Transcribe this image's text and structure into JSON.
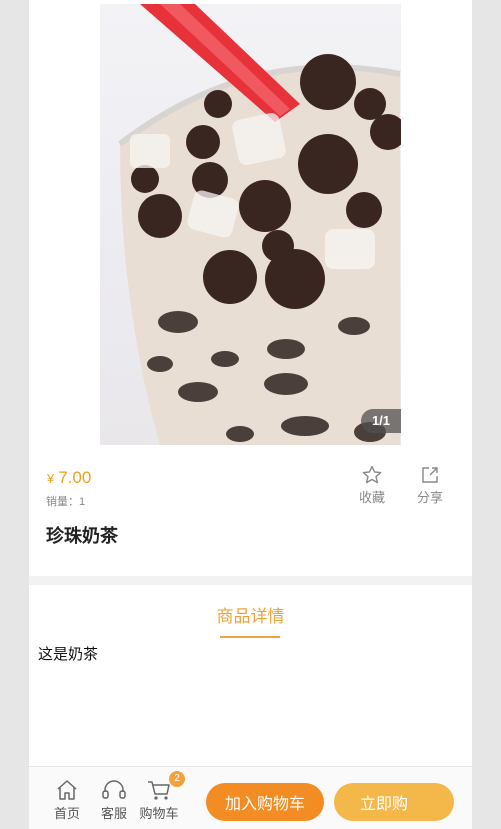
{
  "product": {
    "image_pager": "1/1",
    "currency": "¥",
    "price": "7.00",
    "sales": "销量：1",
    "name": "珍珠奶茶"
  },
  "actions": {
    "favorite_label": "收藏",
    "share_label": "分享"
  },
  "detail": {
    "tab_label": "商品详情",
    "description": "这是奶茶"
  },
  "bottom_nav": {
    "home_label": "首页",
    "service_label": "客服",
    "cart_label": "购物车",
    "cart_count": "2",
    "add_to_cart_label": "加入购物车",
    "buy_now_label": "立即购"
  },
  "colors": {
    "accent": "#f2a23a",
    "add_to_cart": "#f28c23",
    "buy_now": "#f4b84a"
  },
  "icons": [
    "star-icon",
    "share-icon",
    "home-icon",
    "headset-icon",
    "cart-icon"
  ]
}
